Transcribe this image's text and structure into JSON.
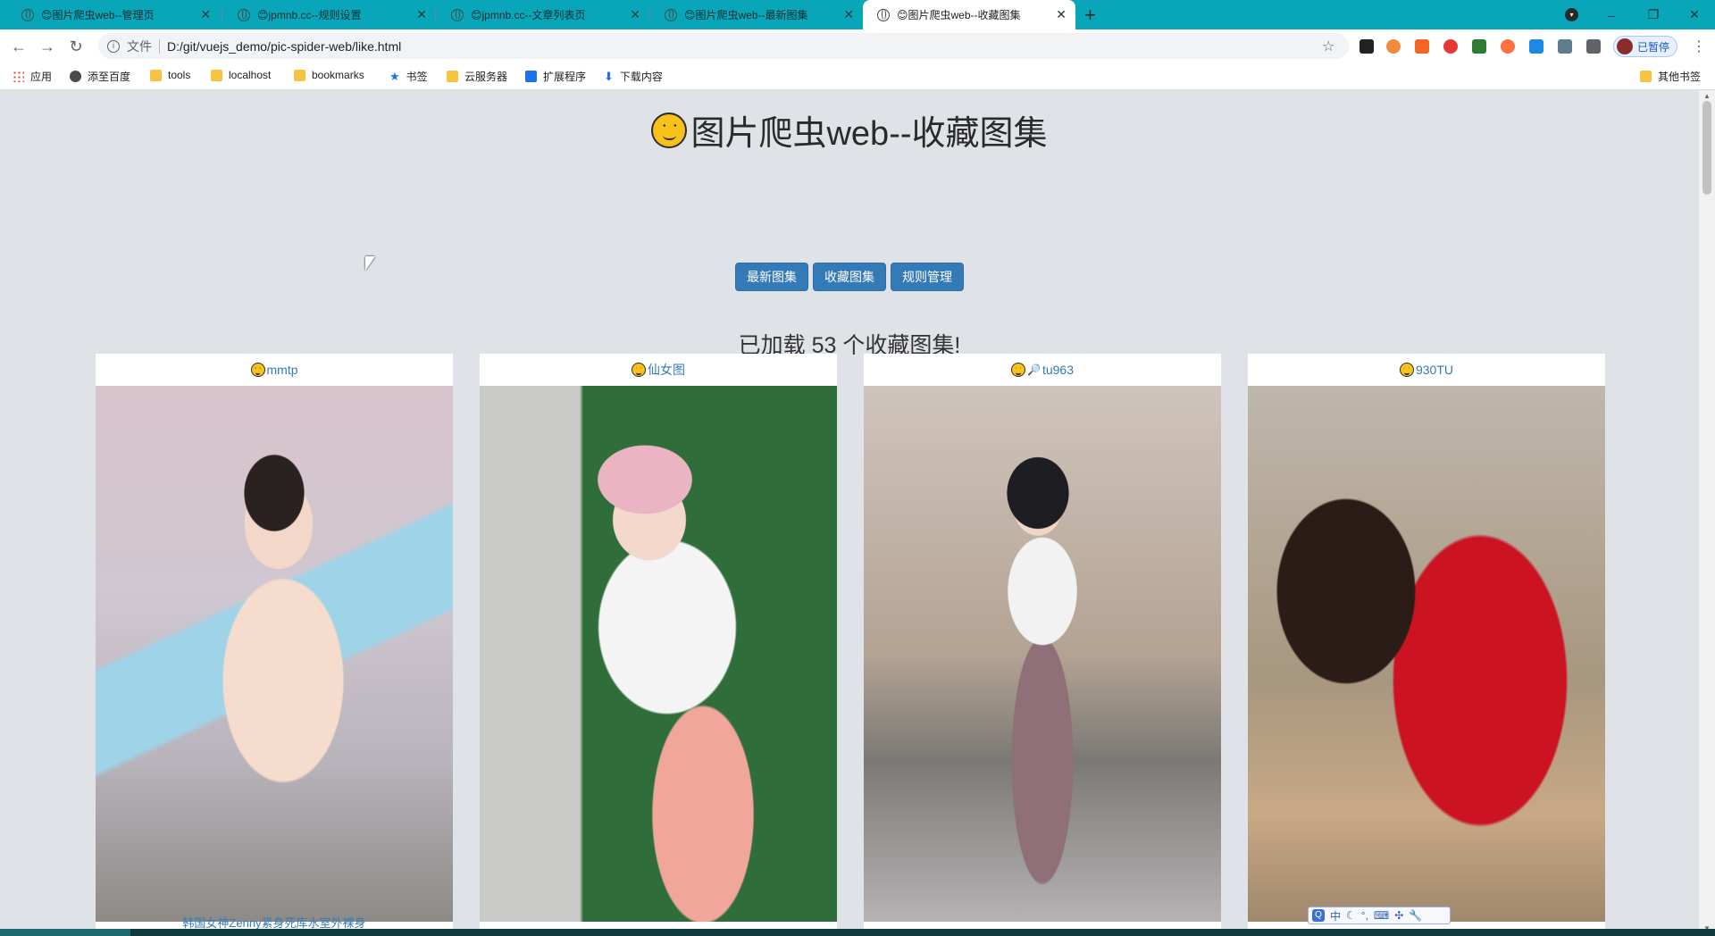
{
  "browser": {
    "tabs": [
      {
        "title": "😊图片爬虫web--管理页",
        "active": false
      },
      {
        "title": "😊jpmnb.cc--规则设置",
        "active": false
      },
      {
        "title": "😊jpmnb.cc--文章列表页",
        "active": false
      },
      {
        "title": "😊图片爬虫web--最新图集",
        "active": false
      },
      {
        "title": "😊图片爬虫web--收藏图集",
        "active": true
      }
    ],
    "new_tab": "+",
    "address": {
      "scheme_label": "文件",
      "url": "D:/git/vuejs_demo/pic-spider-web/like.html"
    },
    "profile_button": "已暂停",
    "window_controls": {
      "minimize": "–",
      "restore": "❐",
      "close": "✕"
    }
  },
  "bookmarks": [
    {
      "label": "应用",
      "icon": "apps-icon"
    },
    {
      "label": "添至百度",
      "icon": "globe-icon"
    },
    {
      "label": "tools",
      "icon": "folder-icon"
    },
    {
      "label": "localhost",
      "icon": "folder-icon"
    },
    {
      "label": "bookmarks",
      "icon": "folder-icon"
    },
    {
      "label": "书签",
      "icon": "star-icon"
    },
    {
      "label": "云服务器",
      "icon": "folder-icon"
    },
    {
      "label": "扩展程序",
      "icon": "puzzle-icon"
    },
    {
      "label": "下载内容",
      "icon": "download-icon"
    }
  ],
  "other_bookmarks": "其他书签",
  "page": {
    "title": "图片爬虫web--收藏图集",
    "nav_buttons": [
      "最新图集",
      "收藏图集",
      "规则管理"
    ],
    "loaded_message": "已加载 53 个收藏图集!",
    "cards": [
      {
        "source": "mmtp",
        "has_magnifier": false,
        "caption": "韩国女神Zenny紧身死库水室外裸身"
      },
      {
        "source": "仙女图",
        "has_magnifier": false,
        "caption": ""
      },
      {
        "source": "tu963",
        "has_magnifier": true,
        "caption": ""
      },
      {
        "source": "930TU",
        "has_magnifier": false,
        "caption": ""
      }
    ]
  },
  "colors": {
    "tabstrip": "#08a6b8",
    "page_bg": "#dfe3e8",
    "button_primary": "#337ab7",
    "link": "#337ab7"
  },
  "ime_toolbar": {
    "mode": "中"
  }
}
